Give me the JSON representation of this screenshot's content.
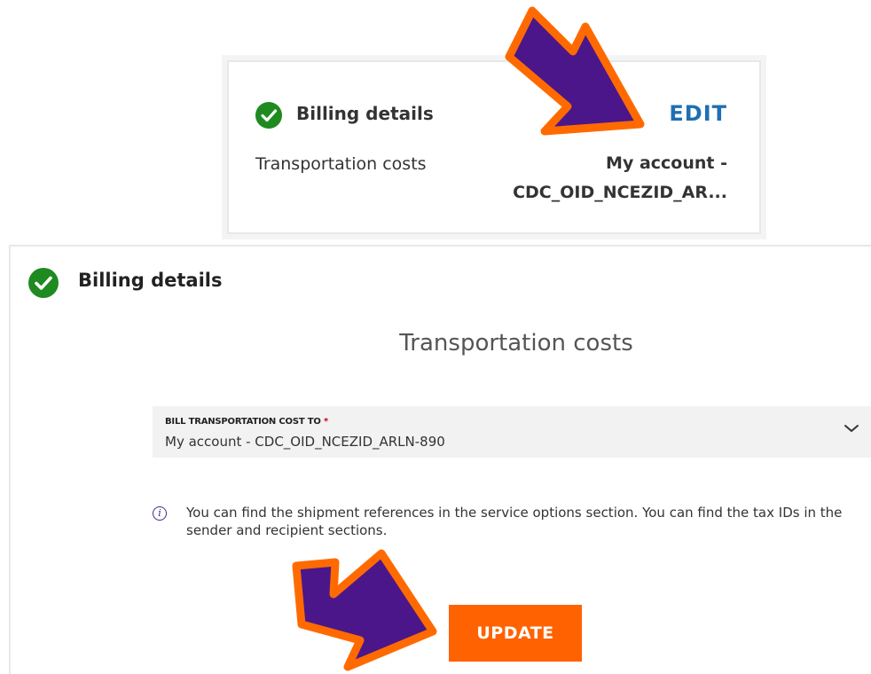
{
  "summary_card": {
    "title": "Billing details",
    "edit_label": "EDIT",
    "row_label": "Transportation costs",
    "row_value_line1": "My account -",
    "row_value_line2": "CDC_OID_NCEZID_AR..."
  },
  "edit_panel": {
    "title": "Billing details",
    "section_heading": "Transportation costs",
    "bill_field": {
      "label": "BILL TRANSPORTATION COST TO",
      "required_mark": "*",
      "value": "My account - CDC_OID_NCEZID_ARLN-890"
    },
    "info_text": "You can find the shipment references in the service options section. You can find the tax IDs in the sender and recipient sections.",
    "update_label": "UPDATE"
  },
  "icons": {
    "status": "check-circle-icon",
    "dropdown": "chevron-down-icon",
    "info": "info-icon",
    "annotation": "arrow-icon"
  },
  "colors": {
    "success_green": "#1f8a1f",
    "link_blue": "#1f6fb2",
    "primary_orange": "#ff6200",
    "arrow_purple": "#4b168a",
    "arrow_outline": "#ff6a00",
    "field_background": "#f2f2f2"
  }
}
